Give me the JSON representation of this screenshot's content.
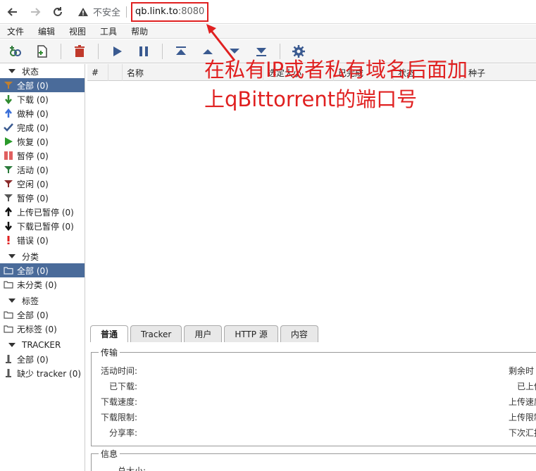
{
  "browser": {
    "insecure_label": "不安全",
    "url_host": "qb.link.to",
    "url_port": ":8080"
  },
  "menu": [
    "文件",
    "编辑",
    "视图",
    "工具",
    "帮助"
  ],
  "annotation": {
    "line1": "在私有IP或者私有域名后面加",
    "line2": "上qBittorrent的端口号"
  },
  "sidebar": {
    "status": {
      "title": "状态",
      "items": [
        {
          "label": "全部 (0)",
          "icon": "filter-icon",
          "color": "#c08030"
        },
        {
          "label": "下载 (0)",
          "icon": "arrow-down-icon",
          "color": "#2f8a2f"
        },
        {
          "label": "做种 (0)",
          "icon": "arrow-up-icon",
          "color": "#3a6fd8"
        },
        {
          "label": "完成 (0)",
          "icon": "check-icon",
          "color": "#3a5a90"
        },
        {
          "label": "恢复 (0)",
          "icon": "play-icon",
          "color": "#2a9a2a"
        },
        {
          "label": "暂停 (0)",
          "icon": "pause-icon",
          "color": "#e06060"
        },
        {
          "label": "活动 (0)",
          "icon": "filter-icon",
          "color": "#2a7a3a"
        },
        {
          "label": "空闲 (0)",
          "icon": "filter-icon",
          "color": "#8a2a2a"
        },
        {
          "label": "暂停 (0)",
          "icon": "filter-icon",
          "color": "#555555"
        },
        {
          "label": "上传已暂停 (0)",
          "icon": "arrow-up-icon",
          "color": "#111111"
        },
        {
          "label": "下载已暂停 (0)",
          "icon": "arrow-down-icon",
          "color": "#111111"
        },
        {
          "label": "错误 (0)",
          "icon": "error-icon",
          "color": "#e02020"
        }
      ]
    },
    "categories": {
      "title": "分类",
      "items": [
        {
          "label": "全部 (0)",
          "icon": "folder-icon"
        },
        {
          "label": "未分类 (0)",
          "icon": "folder-icon"
        }
      ]
    },
    "tags": {
      "title": "标签",
      "items": [
        {
          "label": "全部 (0)",
          "icon": "folder-icon"
        },
        {
          "label": "无标签 (0)",
          "icon": "folder-icon"
        }
      ]
    },
    "trackers": {
      "title": "TRACKER",
      "items": [
        {
          "label": "全部 (0)",
          "icon": "tracker-icon"
        },
        {
          "label": "缺少 tracker (0)",
          "icon": "tracker-icon"
        }
      ]
    }
  },
  "table": {
    "columns": [
      "#",
      "",
      "名称",
      "选定大小",
      "已完成",
      "状态",
      "种子"
    ]
  },
  "tabs": [
    "普通",
    "Tracker",
    "用户",
    "HTTP 源",
    "内容"
  ],
  "transfer": {
    "legend": "传输",
    "left_labels": [
      "活动时间:",
      "已下载:",
      "下载速度:",
      "下载限制:",
      "分享率:"
    ],
    "right_labels": [
      "剩余时",
      "已上传",
      "上传速度",
      "上传限制",
      "下次汇报"
    ]
  },
  "info": {
    "legend": "信息",
    "first_label": "总大小:"
  },
  "colors": {
    "accent_red": "#e02020",
    "selected_bg": "#4a6b9a"
  }
}
